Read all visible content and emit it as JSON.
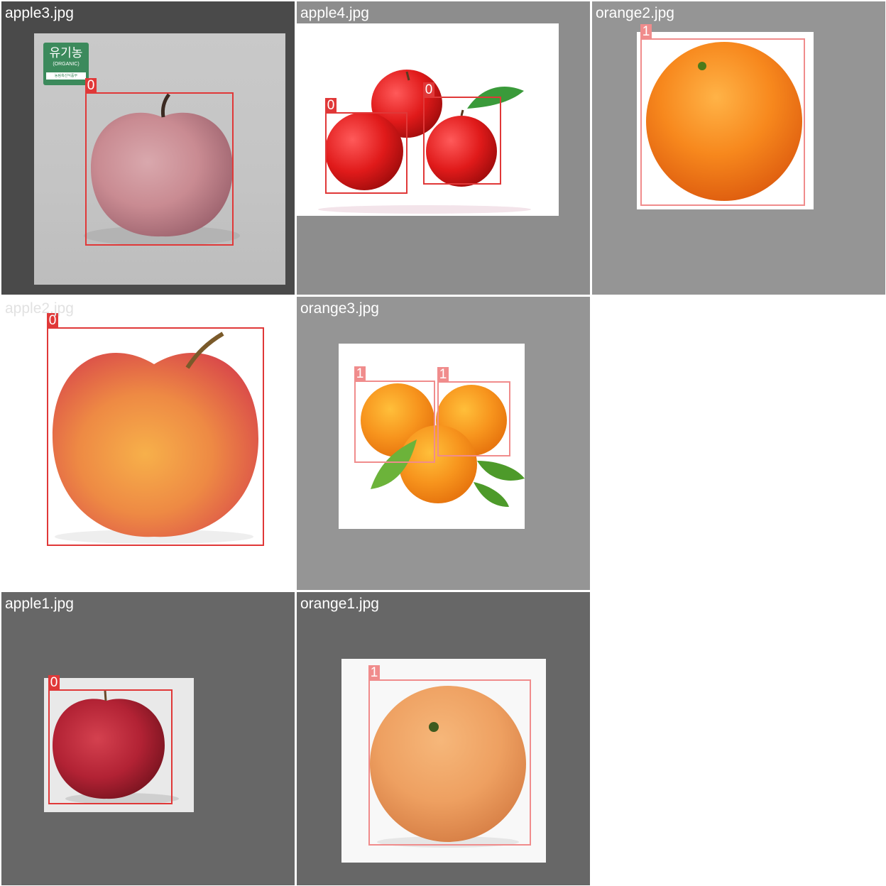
{
  "colors": {
    "class_0_box": "#e03838",
    "class_1_box": "#f08c8c",
    "tile_bg_dark": "#4a4a4a",
    "tile_bg_mid": "#919191",
    "tile_bg_darker": "#676767"
  },
  "tiles": [
    {
      "filename": "apple3.jpg",
      "fruit": "apple",
      "detections": [
        {
          "class_label": "0"
        }
      ],
      "organic_badge": {
        "korean": "유기농",
        "english": "(ORGANIC)",
        "small": "농림축산식품부"
      }
    },
    {
      "filename": "apple4.jpg",
      "fruit": "apple",
      "detections": [
        {
          "class_label": "0"
        },
        {
          "class_label": "0"
        }
      ]
    },
    {
      "filename": "orange2.jpg",
      "fruit": "orange",
      "detections": [
        {
          "class_label": "1"
        }
      ]
    },
    {
      "filename": "apple2.jpg",
      "fruit": "apple",
      "detections": [
        {
          "class_label": "0"
        }
      ]
    },
    {
      "filename": "orange3.jpg",
      "fruit": "orange",
      "detections": [
        {
          "class_label": "1"
        },
        {
          "class_label": "1"
        }
      ]
    },
    {
      "filename": "apple1.jpg",
      "fruit": "apple",
      "detections": [
        {
          "class_label": "0"
        }
      ]
    },
    {
      "filename": "orange1.jpg",
      "fruit": "orange",
      "detections": [
        {
          "class_label": "1"
        }
      ]
    }
  ]
}
